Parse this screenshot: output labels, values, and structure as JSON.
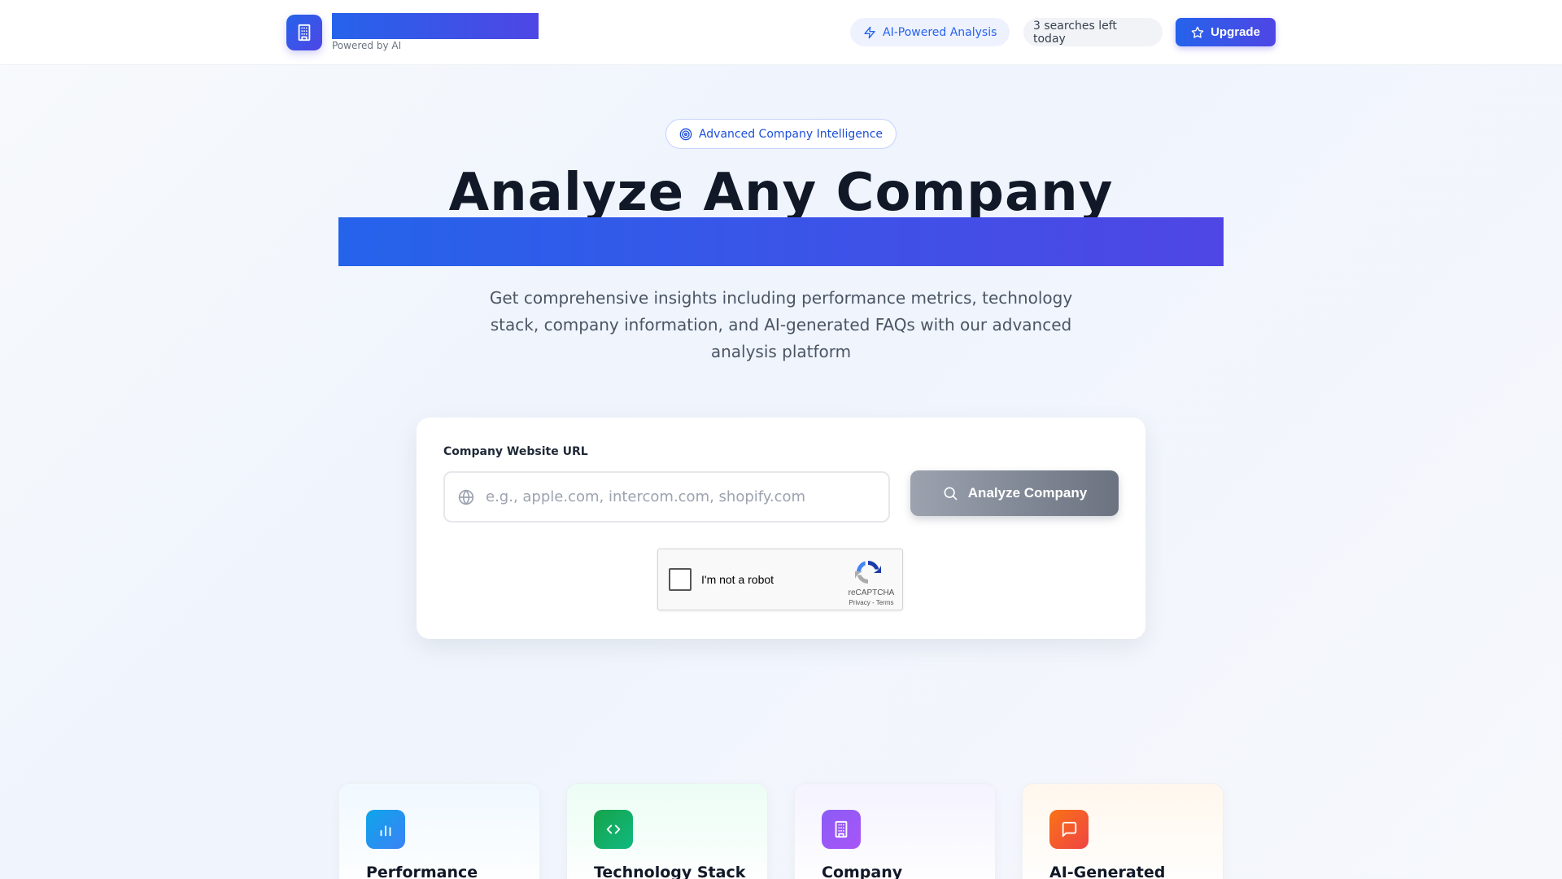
{
  "header": {
    "brand_sub": "Powered by AI",
    "ai_pill": "AI-Powered Analysis",
    "searches_left": "3 searches left today",
    "upgrade_label": "Upgrade"
  },
  "hero": {
    "badge": "Advanced Company Intelligence",
    "title": "Analyze Any Company",
    "description": "Get comprehensive insights including performance metrics, technology stack, company information, and AI-generated FAQs with our advanced analysis platform"
  },
  "search": {
    "label": "Company Website URL",
    "placeholder": "e.g., apple.com, intercom.com, shopify.com",
    "value": "",
    "analyze_label": "Analyze Company"
  },
  "captcha": {
    "text": "I'm not a robot",
    "brand": "reCAPTCHA",
    "links": "Privacy - Terms"
  },
  "features": [
    {
      "title": "Performance",
      "icon": "bar-chart-icon",
      "color": "#0ea5e9"
    },
    {
      "title": "Technology Stack",
      "icon": "code-icon",
      "color": "#16a34a"
    },
    {
      "title": "Company",
      "icon": "building-icon",
      "color": "#8b5cf6"
    },
    {
      "title": "AI-Generated",
      "icon": "chat-icon",
      "color": "#f97316"
    }
  ],
  "colors": {
    "accent_start": "#2563eb",
    "accent_end": "#4f46e5"
  }
}
